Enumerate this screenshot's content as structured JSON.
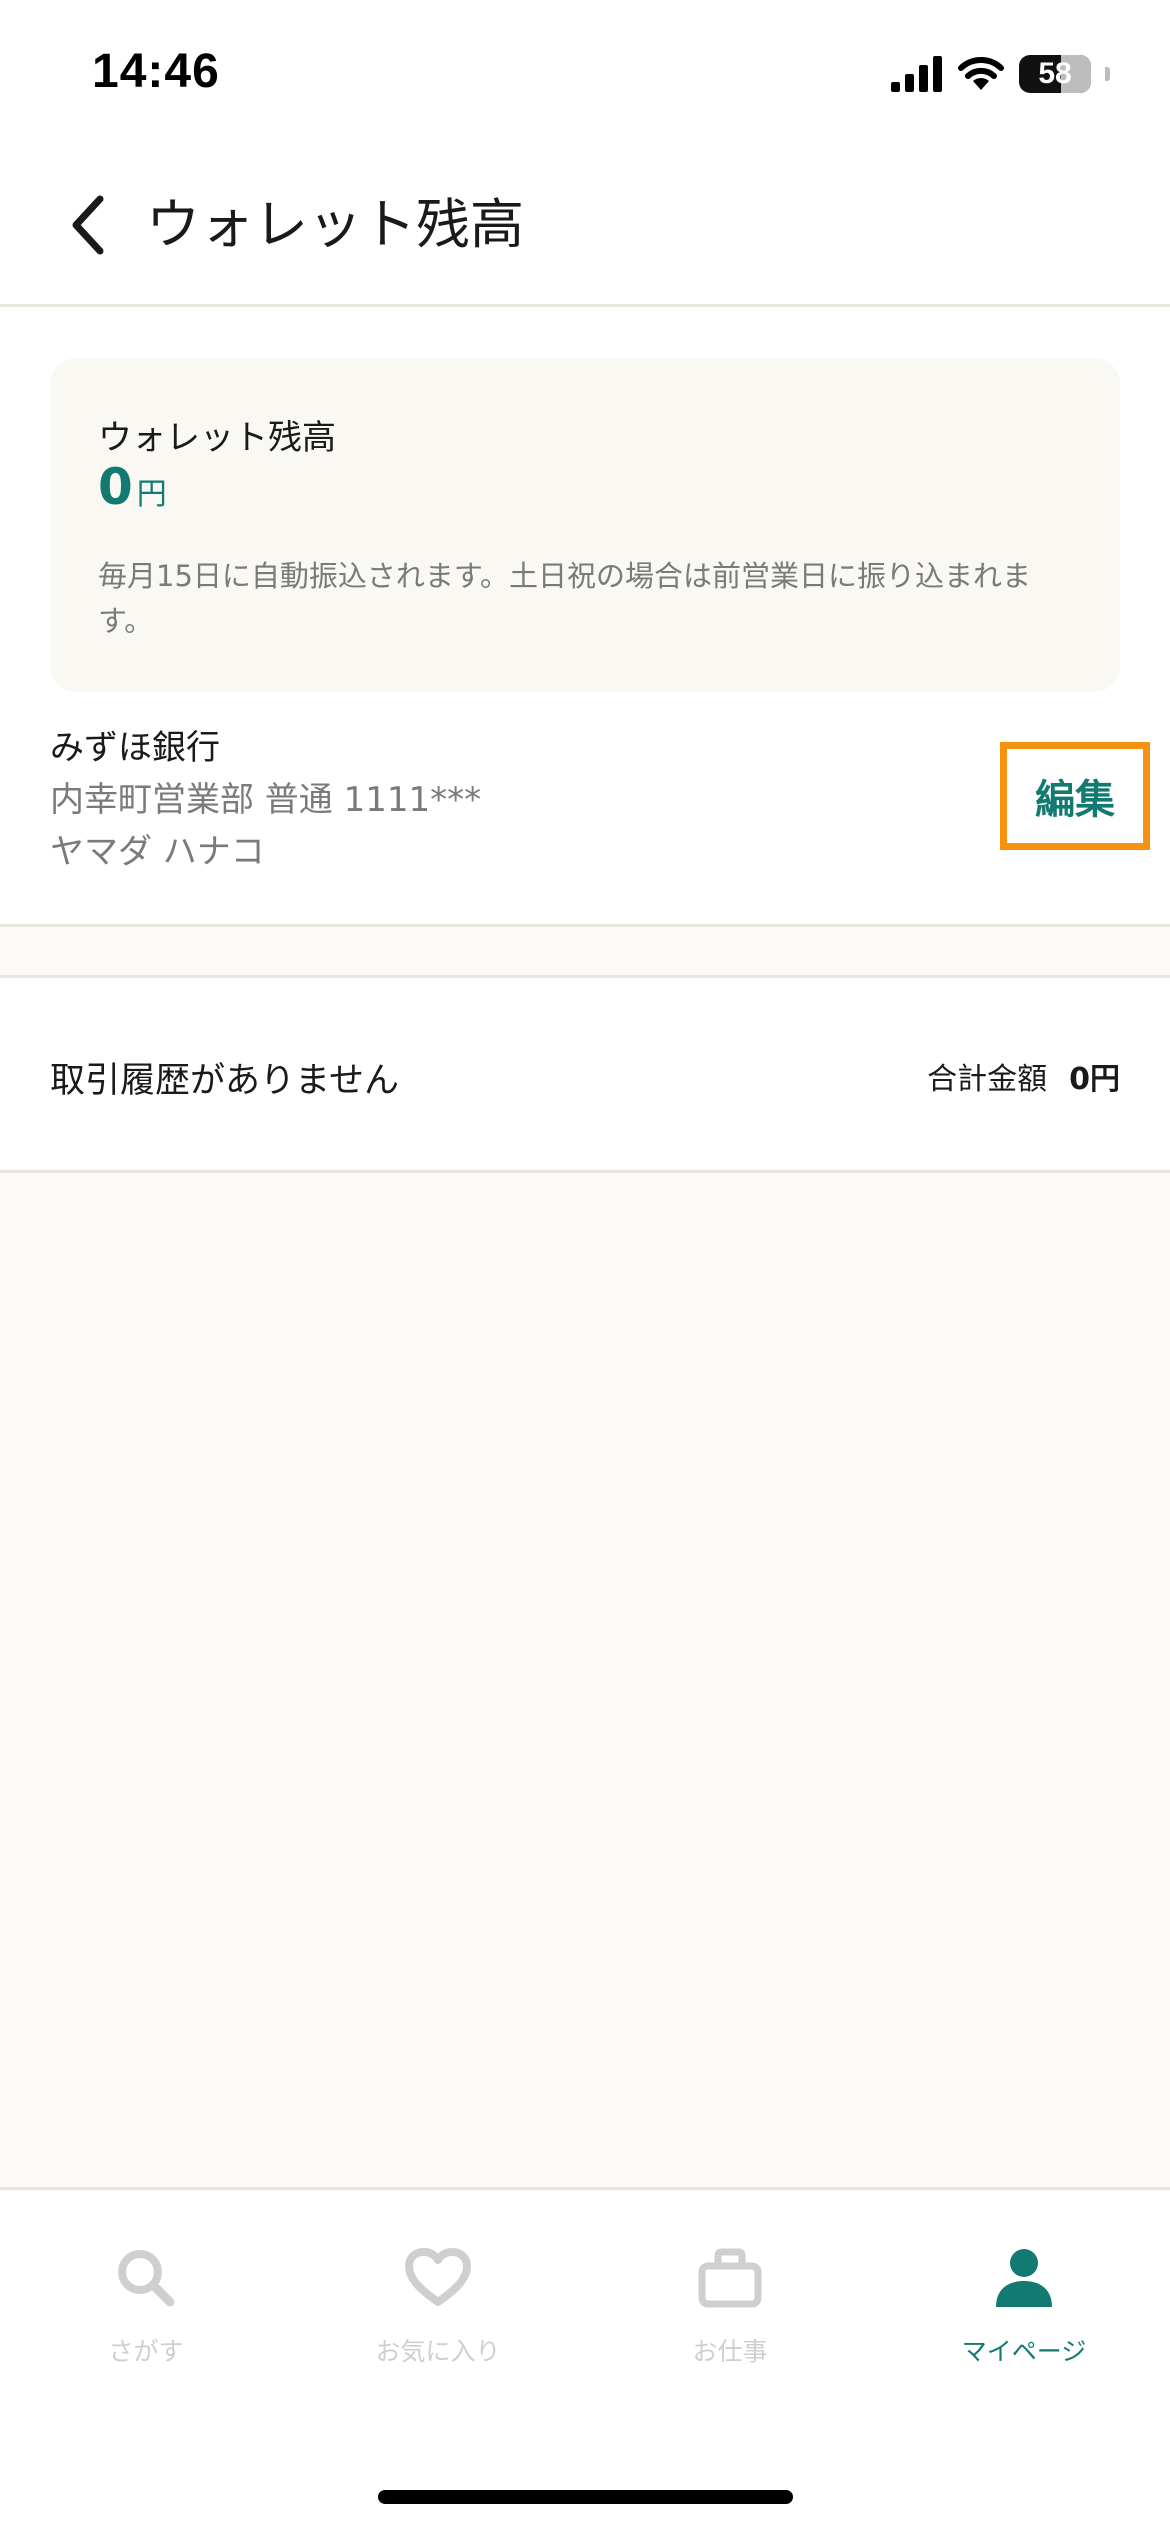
{
  "status_bar": {
    "time": "14:46",
    "battery_level": "58"
  },
  "header": {
    "title": "ウォレット残高"
  },
  "balance_card": {
    "label": "ウォレット残高",
    "amount": "0",
    "unit": "円",
    "note": "毎月15日に自動振込されます。土日祝の場合は前営業日に振り込まれます。"
  },
  "bank_account": {
    "bank_name": "みずほ銀行",
    "branch_line": "内幸町営業部 普通 1111***",
    "holder": "ヤマダ ハナコ",
    "edit_label": "編集"
  },
  "history": {
    "empty_message": "取引履歴がありません",
    "total_label": "合計金額",
    "total_amount": "0円"
  },
  "tabbar": {
    "accent_color": "#137a72",
    "inactive_color": "#cfcfcf",
    "tabs": [
      {
        "label": "さがす",
        "icon": "search-icon",
        "active": false
      },
      {
        "label": "お気に入り",
        "icon": "heart-icon",
        "active": false
      },
      {
        "label": "お仕事",
        "icon": "briefcase-icon",
        "active": false
      },
      {
        "label": "マイページ",
        "icon": "person-icon",
        "active": true
      }
    ]
  }
}
